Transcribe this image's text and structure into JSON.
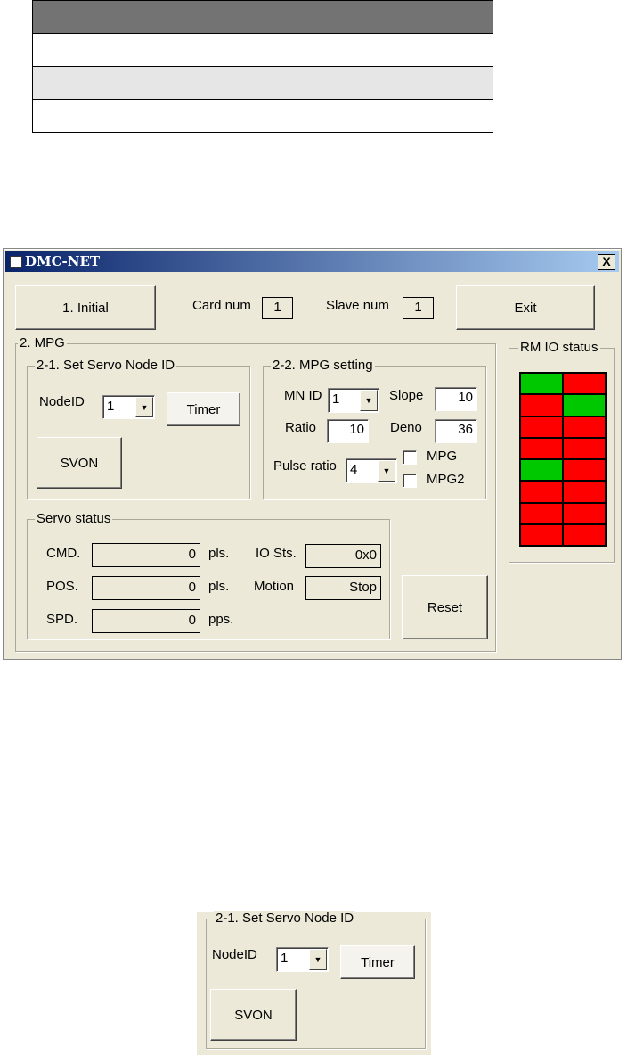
{
  "window": {
    "title": "DMC-NET",
    "close": "X"
  },
  "top": {
    "initial": "1. Initial",
    "card_label": "Card num",
    "card_value": "1",
    "slave_label": "Slave num",
    "slave_value": "1",
    "exit": "Exit"
  },
  "mpg": {
    "title": "2. MPG",
    "servo_node": {
      "title": "2-1. Set Servo Node ID",
      "nodeid_label": "NodeID",
      "nodeid_value": "1",
      "timer": "Timer",
      "svon": "SVON"
    },
    "setting": {
      "title": "2-2. MPG setting",
      "mnid_label": "MN ID",
      "mnid_value": "1",
      "slope_label": "Slope",
      "slope_value": "10",
      "ratio_label": "Ratio",
      "ratio_value": "10",
      "deno_label": "Deno",
      "deno_value": "36",
      "pulse_label": "Pulse ratio",
      "pulse_value": "4",
      "mpg": "MPG",
      "mpg2": "MPG2"
    },
    "servo_status": {
      "title": "Servo status",
      "cmd_label": "CMD.",
      "cmd_value": "0",
      "cmd_unit": "pls.",
      "pos_label": "POS.",
      "pos_value": "0",
      "pos_unit": "pls.",
      "spd_label": "SPD.",
      "spd_value": "0",
      "spd_unit": "pps.",
      "io_label": "IO Sts.",
      "io_value": "0x0",
      "motion_label": "Motion",
      "motion_value": "Stop"
    },
    "reset": "Reset"
  },
  "rmio": {
    "title": "RM IO status",
    "on_color": "#00c800",
    "off_color": "#ff0000",
    "states": [
      1,
      0,
      0,
      1,
      0,
      0,
      0,
      0,
      1,
      0,
      0,
      0,
      0,
      0,
      0,
      0
    ]
  }
}
